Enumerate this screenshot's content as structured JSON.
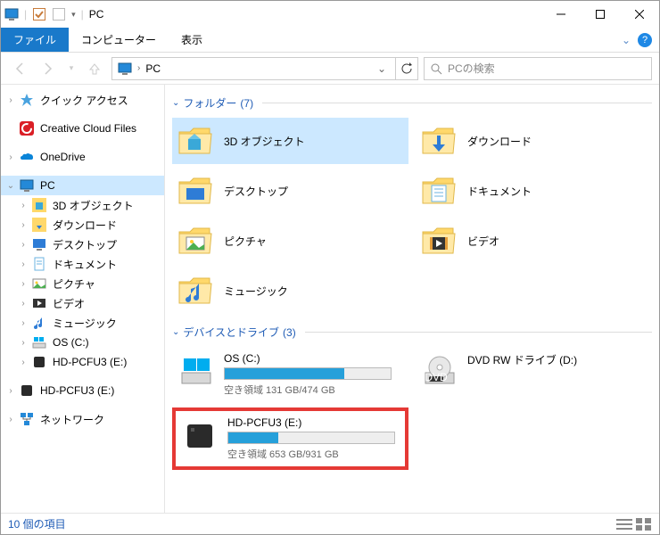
{
  "window": {
    "title": "PC"
  },
  "ribbon": {
    "file": "ファイル",
    "computer": "コンピューター",
    "view": "表示"
  },
  "address": {
    "location": "PC"
  },
  "search": {
    "placeholder": "PCの検索"
  },
  "sidebar": [
    {
      "label": "クイック アクセス",
      "icon": "quick-access",
      "level": 1,
      "tw": ">"
    },
    {
      "spacer": true
    },
    {
      "label": "Creative Cloud Files",
      "icon": "cc",
      "level": 1,
      "tw": ""
    },
    {
      "spacer": true
    },
    {
      "label": "OneDrive",
      "icon": "onedrive",
      "level": 1,
      "tw": ">"
    },
    {
      "spacer": true
    },
    {
      "label": "PC",
      "icon": "pc",
      "level": 1,
      "tw": "v",
      "selected": true
    },
    {
      "label": "3D オブジェクト",
      "icon": "3d",
      "level": 2,
      "tw": ">"
    },
    {
      "label": "ダウンロード",
      "icon": "downloads",
      "level": 2,
      "tw": ">"
    },
    {
      "label": "デスクトップ",
      "icon": "desktop",
      "level": 2,
      "tw": ">"
    },
    {
      "label": "ドキュメント",
      "icon": "documents",
      "level": 2,
      "tw": ">"
    },
    {
      "label": "ピクチャ",
      "icon": "pictures",
      "level": 2,
      "tw": ">"
    },
    {
      "label": "ビデオ",
      "icon": "videos",
      "level": 2,
      "tw": ">"
    },
    {
      "label": "ミュージック",
      "icon": "music",
      "level": 2,
      "tw": ">"
    },
    {
      "label": "OS (C:)",
      "icon": "drive-win",
      "level": 2,
      "tw": ">"
    },
    {
      "label": "HD-PCFU3 (E:)",
      "icon": "drive-ext",
      "level": 2,
      "tw": ">"
    },
    {
      "spacer": true
    },
    {
      "label": "HD-PCFU3 (E:)",
      "icon": "drive-ext",
      "level": 1,
      "tw": ">"
    },
    {
      "spacer": true
    },
    {
      "label": "ネットワーク",
      "icon": "network",
      "level": 1,
      "tw": ">"
    }
  ],
  "groups": {
    "folders": {
      "label": "フォルダー",
      "count": "(7)"
    },
    "drives": {
      "label": "デバイスとドライブ",
      "count": "(3)"
    }
  },
  "folders": [
    {
      "label": "3D オブジェクト",
      "icon": "3d",
      "selected": true
    },
    {
      "label": "ダウンロード",
      "icon": "downloads"
    },
    {
      "label": "デスクトップ",
      "icon": "desktop"
    },
    {
      "label": "ドキュメント",
      "icon": "documents"
    },
    {
      "label": "ピクチャ",
      "icon": "pictures"
    },
    {
      "label": "ビデオ",
      "icon": "videos"
    },
    {
      "label": "ミュージック",
      "icon": "music"
    }
  ],
  "drives": [
    {
      "name": "OS (C:)",
      "icon": "drive-win",
      "free": "空き領域 131 GB/474 GB",
      "used_pct": 72
    },
    {
      "name": "DVD RW ドライブ (D:)",
      "icon": "dvd",
      "nobar": true
    },
    {
      "name": "HD-PCFU3 (E:)",
      "icon": "drive-ext",
      "free": "空き領域 653 GB/931 GB",
      "used_pct": 30,
      "highlight": true
    }
  ],
  "status": {
    "items": "10 個の項目"
  }
}
